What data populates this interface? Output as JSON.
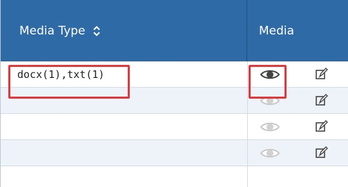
{
  "table": {
    "headers": {
      "media_type": "Media Type",
      "media": "Media"
    },
    "rows": [
      {
        "media_type": "docx(1),txt(1)",
        "view_icon": "eye-icon",
        "edit_icon": "edit-icon"
      },
      {
        "media_type": "",
        "view_icon": "eye-icon",
        "edit_icon": "edit-icon"
      },
      {
        "media_type": "",
        "view_icon": "eye-icon",
        "edit_icon": "edit-icon"
      },
      {
        "media_type": "",
        "view_icon": "eye-icon",
        "edit_icon": "edit-icon"
      }
    ]
  },
  "colors": {
    "header_bg": "#2e6aa6",
    "highlight": "#e0383b",
    "row_alt": "#eef3f9"
  }
}
